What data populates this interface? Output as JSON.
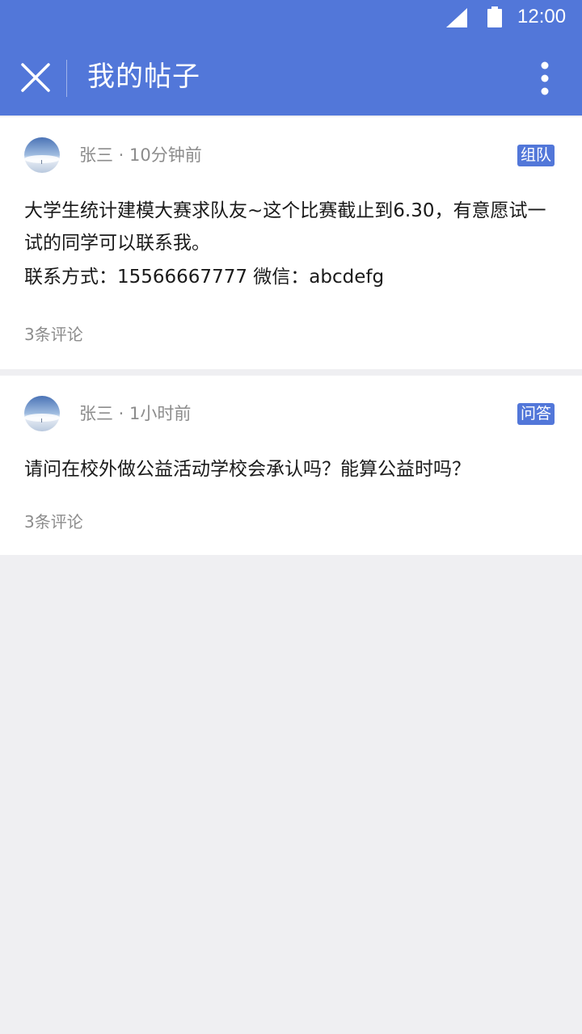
{
  "status_bar": {
    "time": "12:00",
    "icons": [
      "signal-icon",
      "battery-icon"
    ]
  },
  "app_bar": {
    "title": "我的帖子",
    "icons": [
      "close-icon",
      "more-vert-icon"
    ]
  },
  "posts": [
    {
      "author": "张三",
      "time_ago": "10分钟前",
      "meta": "张三 · 10分钟前",
      "tag": "组队",
      "content_line1": "大学生统计建模大赛求队友~这个比赛截止到6.30，有意愿试一试的同学可以联系我。",
      "content_line2": "联系方式：15566667777  微信：abcdefg",
      "comments": "3条评论"
    },
    {
      "author": "张三",
      "time_ago": "1小时前",
      "meta": "张三 · 1小时前",
      "tag": "问答",
      "content_line1": "请问在校外做公益活动学校会承认吗？能算公益时吗？",
      "comments": "3条评论"
    }
  ],
  "colors": {
    "primary": "#5277d9",
    "background": "#efeff2",
    "card": "#ffffff",
    "muted_text": "#8c8c8c",
    "body_text": "#1a1a1a"
  }
}
